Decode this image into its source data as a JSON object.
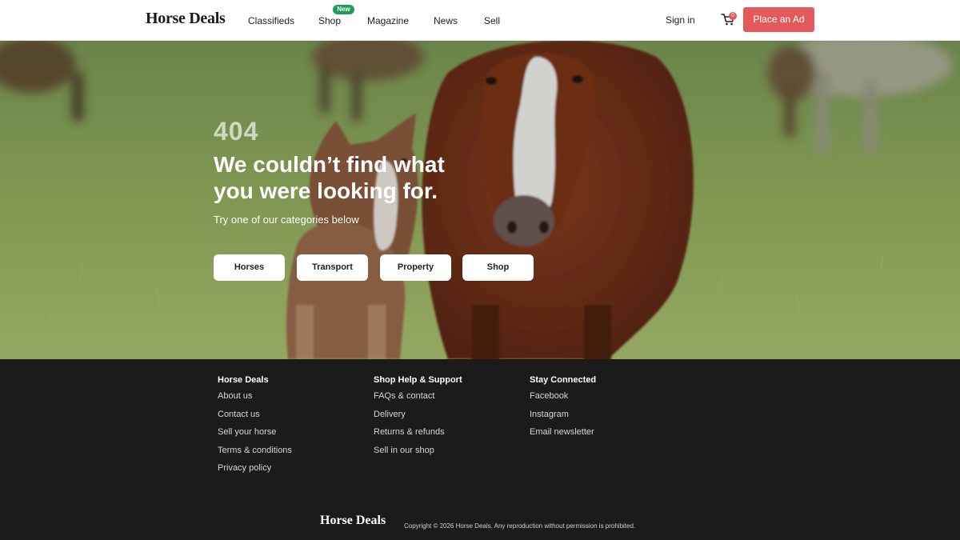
{
  "brand": {
    "name": "Horse Deals"
  },
  "nav": {
    "items": [
      {
        "label": "Classifieds"
      },
      {
        "label": "Shop"
      },
      {
        "label": "Magazine"
      },
      {
        "label": "News"
      },
      {
        "label": "Sell"
      }
    ],
    "shop_badge": "New",
    "signin": "Sign in",
    "cart_count": "0",
    "cta": "Place an Ad"
  },
  "hero": {
    "code": "404",
    "title": "We couldn’t find what you were looking for.",
    "subtitle": "Try one of our categories below",
    "categories": [
      {
        "label": "Horses"
      },
      {
        "label": "Transport"
      },
      {
        "label": "Property"
      },
      {
        "label": "Shop"
      }
    ]
  },
  "footer": {
    "columns": [
      {
        "heading": "Horse Deals",
        "links": [
          "About us",
          "Contact us",
          "Sell your horse",
          "Terms & conditions",
          "Privacy policy"
        ]
      },
      {
        "heading": "Shop Help & Support",
        "links": [
          "FAQs & contact",
          "Delivery",
          "Returns & refunds",
          "Sell in our shop"
        ]
      },
      {
        "heading": "Stay Connected",
        "links": [
          "Facebook",
          "Instagram",
          "Email newsletter"
        ]
      }
    ],
    "copyright": "Copyright © 2026 Horse Deals. Any reproduction without permission is prohibited."
  },
  "colors": {
    "accent": "#e25a5a",
    "badge": "#1f9d55",
    "footer_bg": "#1b1b1b"
  }
}
